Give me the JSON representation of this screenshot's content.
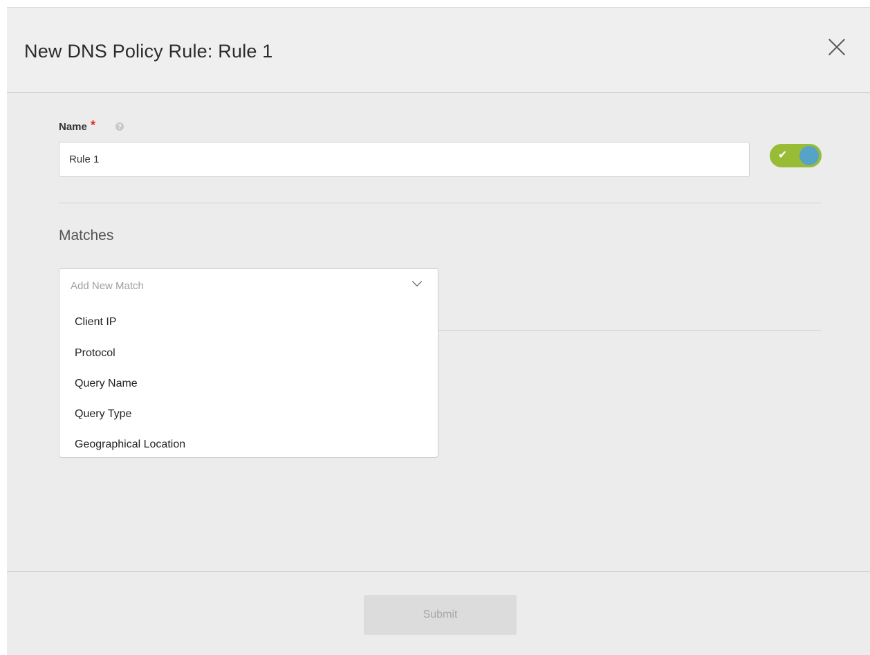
{
  "modal": {
    "title": "New DNS Policy Rule: Rule 1"
  },
  "name_field": {
    "label": "Name",
    "required_mark": "*",
    "value": "Rule 1",
    "help_icon": "question-circle-icon"
  },
  "toggle": {
    "state": "on",
    "check_glyph": "✔",
    "colors": {
      "track": "#98bc35",
      "knob": "#55a3c7"
    }
  },
  "matches": {
    "title": "Matches",
    "select_placeholder": "Add New Match",
    "options": [
      "Client IP",
      "Protocol",
      "Query Name",
      "Query Type",
      "Geographical Location"
    ]
  },
  "footer": {
    "submit_label": "Submit",
    "submit_disabled": true
  }
}
